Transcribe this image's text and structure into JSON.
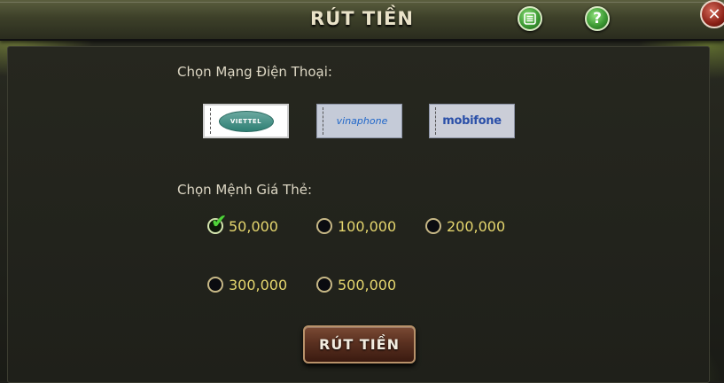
{
  "header": {
    "title": "RÚT TIỀN",
    "list_icon": "list-icon",
    "help_icon": "help-icon",
    "help_glyph": "?",
    "close_icon": "close-icon",
    "close_glyph": "✕"
  },
  "network": {
    "label": "Chọn Mạng Điện Thoại:",
    "carriers": [
      {
        "name": "VIETTEL",
        "logo_text": "VIETTEL",
        "selected": true
      },
      {
        "name": "vinaphone",
        "logo_text": "vinaphone",
        "selected": false
      },
      {
        "name": "mobifone",
        "logo_text": "mobifone",
        "selected": false
      }
    ]
  },
  "denomination": {
    "label": "Chọn Mệnh Giá Thẻ:",
    "options": [
      {
        "value": "50,000",
        "selected": true
      },
      {
        "value": "100,000",
        "selected": false
      },
      {
        "value": "200,000",
        "selected": false
      },
      {
        "value": "300,000",
        "selected": false
      },
      {
        "value": "500,000",
        "selected": false
      }
    ]
  },
  "submit": {
    "label": "RÚT TIỀN"
  },
  "colors": {
    "option_text": "#e5d66e",
    "check_green": "#4fd43a",
    "button_brown": "#5a3020"
  }
}
